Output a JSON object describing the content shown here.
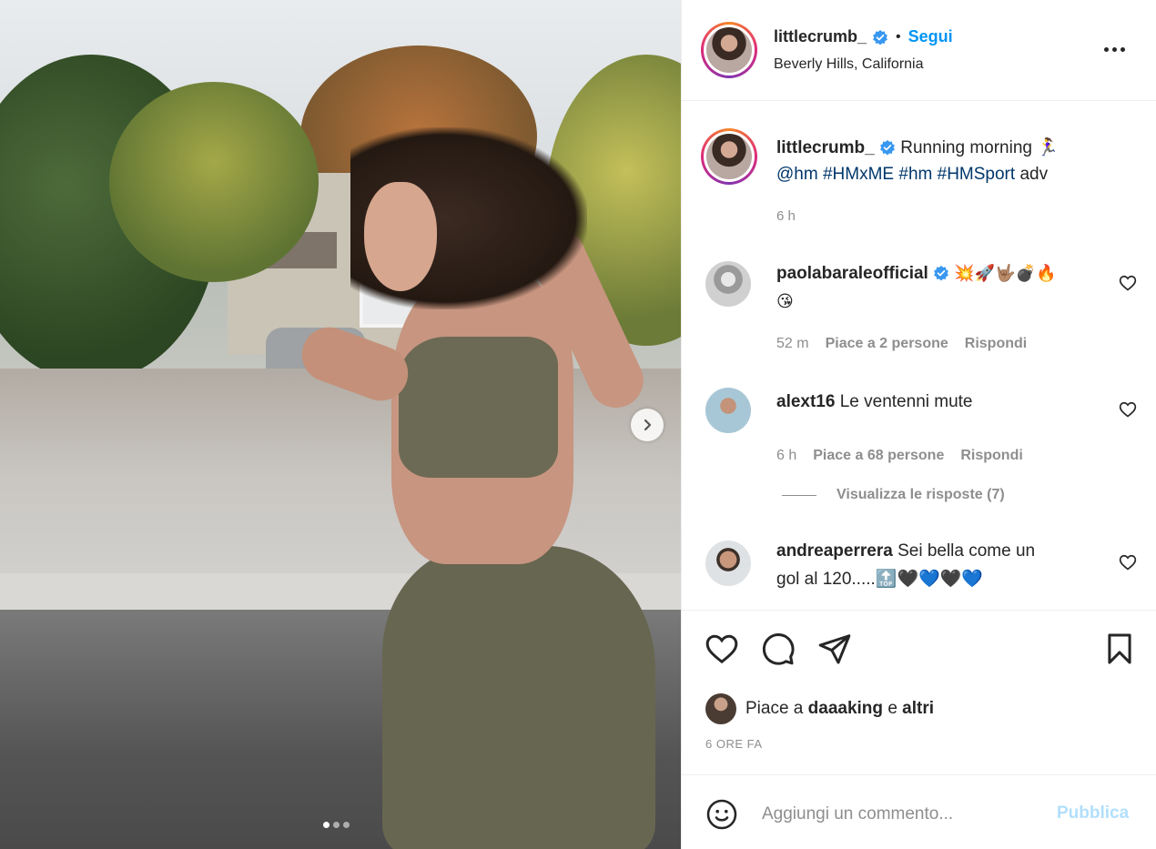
{
  "post": {
    "author": "littlecrumb_",
    "follow_label": "Segui",
    "separator": "•",
    "location": "Beverly Hills, California",
    "slide_count": 3,
    "active_slide": 1
  },
  "caption": {
    "author": "littlecrumb_",
    "text": "Running morning 🏃‍♀️",
    "mention": "@hm",
    "hashtags": [
      "#HMxME",
      "#hm",
      "#HMSport"
    ],
    "suffix": "adv",
    "time": "6 h"
  },
  "comments": [
    {
      "author": "paolabaralele official",
      "display_author": "paolabaraleofficial",
      "verified": true,
      "text": "💥🚀🤟🏽💣🔥",
      "text2": "😘",
      "time": "52 m",
      "likes": "Piace a 2 persone",
      "reply": "Rispondi"
    },
    {
      "author": "alext16",
      "verified": false,
      "text": "Le ventenni mute",
      "time": "6 h",
      "likes": "Piace a 68 persone",
      "reply": "Rispondi",
      "view_replies": "Visualizza le risposte (7)"
    },
    {
      "author": "andreaperrera",
      "verified": false,
      "text": "Sei bella come un",
      "text2": "gol al 120.....🔝🖤💙🖤💙"
    }
  ],
  "likes": {
    "prefix": "Piace a",
    "user": "daaaking",
    "joiner": "e",
    "others": "altri"
  },
  "posted_ago": "6 ORE FA",
  "add_comment": {
    "placeholder": "Aggiungi un commento...",
    "publish_label": "Pubblica"
  },
  "colors": {
    "follow_blue": "#0095f6",
    "link_blue": "#00376b",
    "muted": "#8e8e8e",
    "publish_disabled": "#b2dffc",
    "verified_blue": "#3897f0"
  },
  "icons": [
    "more-options-icon",
    "verified-icon",
    "heart-icon",
    "comment-icon",
    "share-icon",
    "bookmark-icon",
    "emoji-icon",
    "chevron-right-icon"
  ]
}
